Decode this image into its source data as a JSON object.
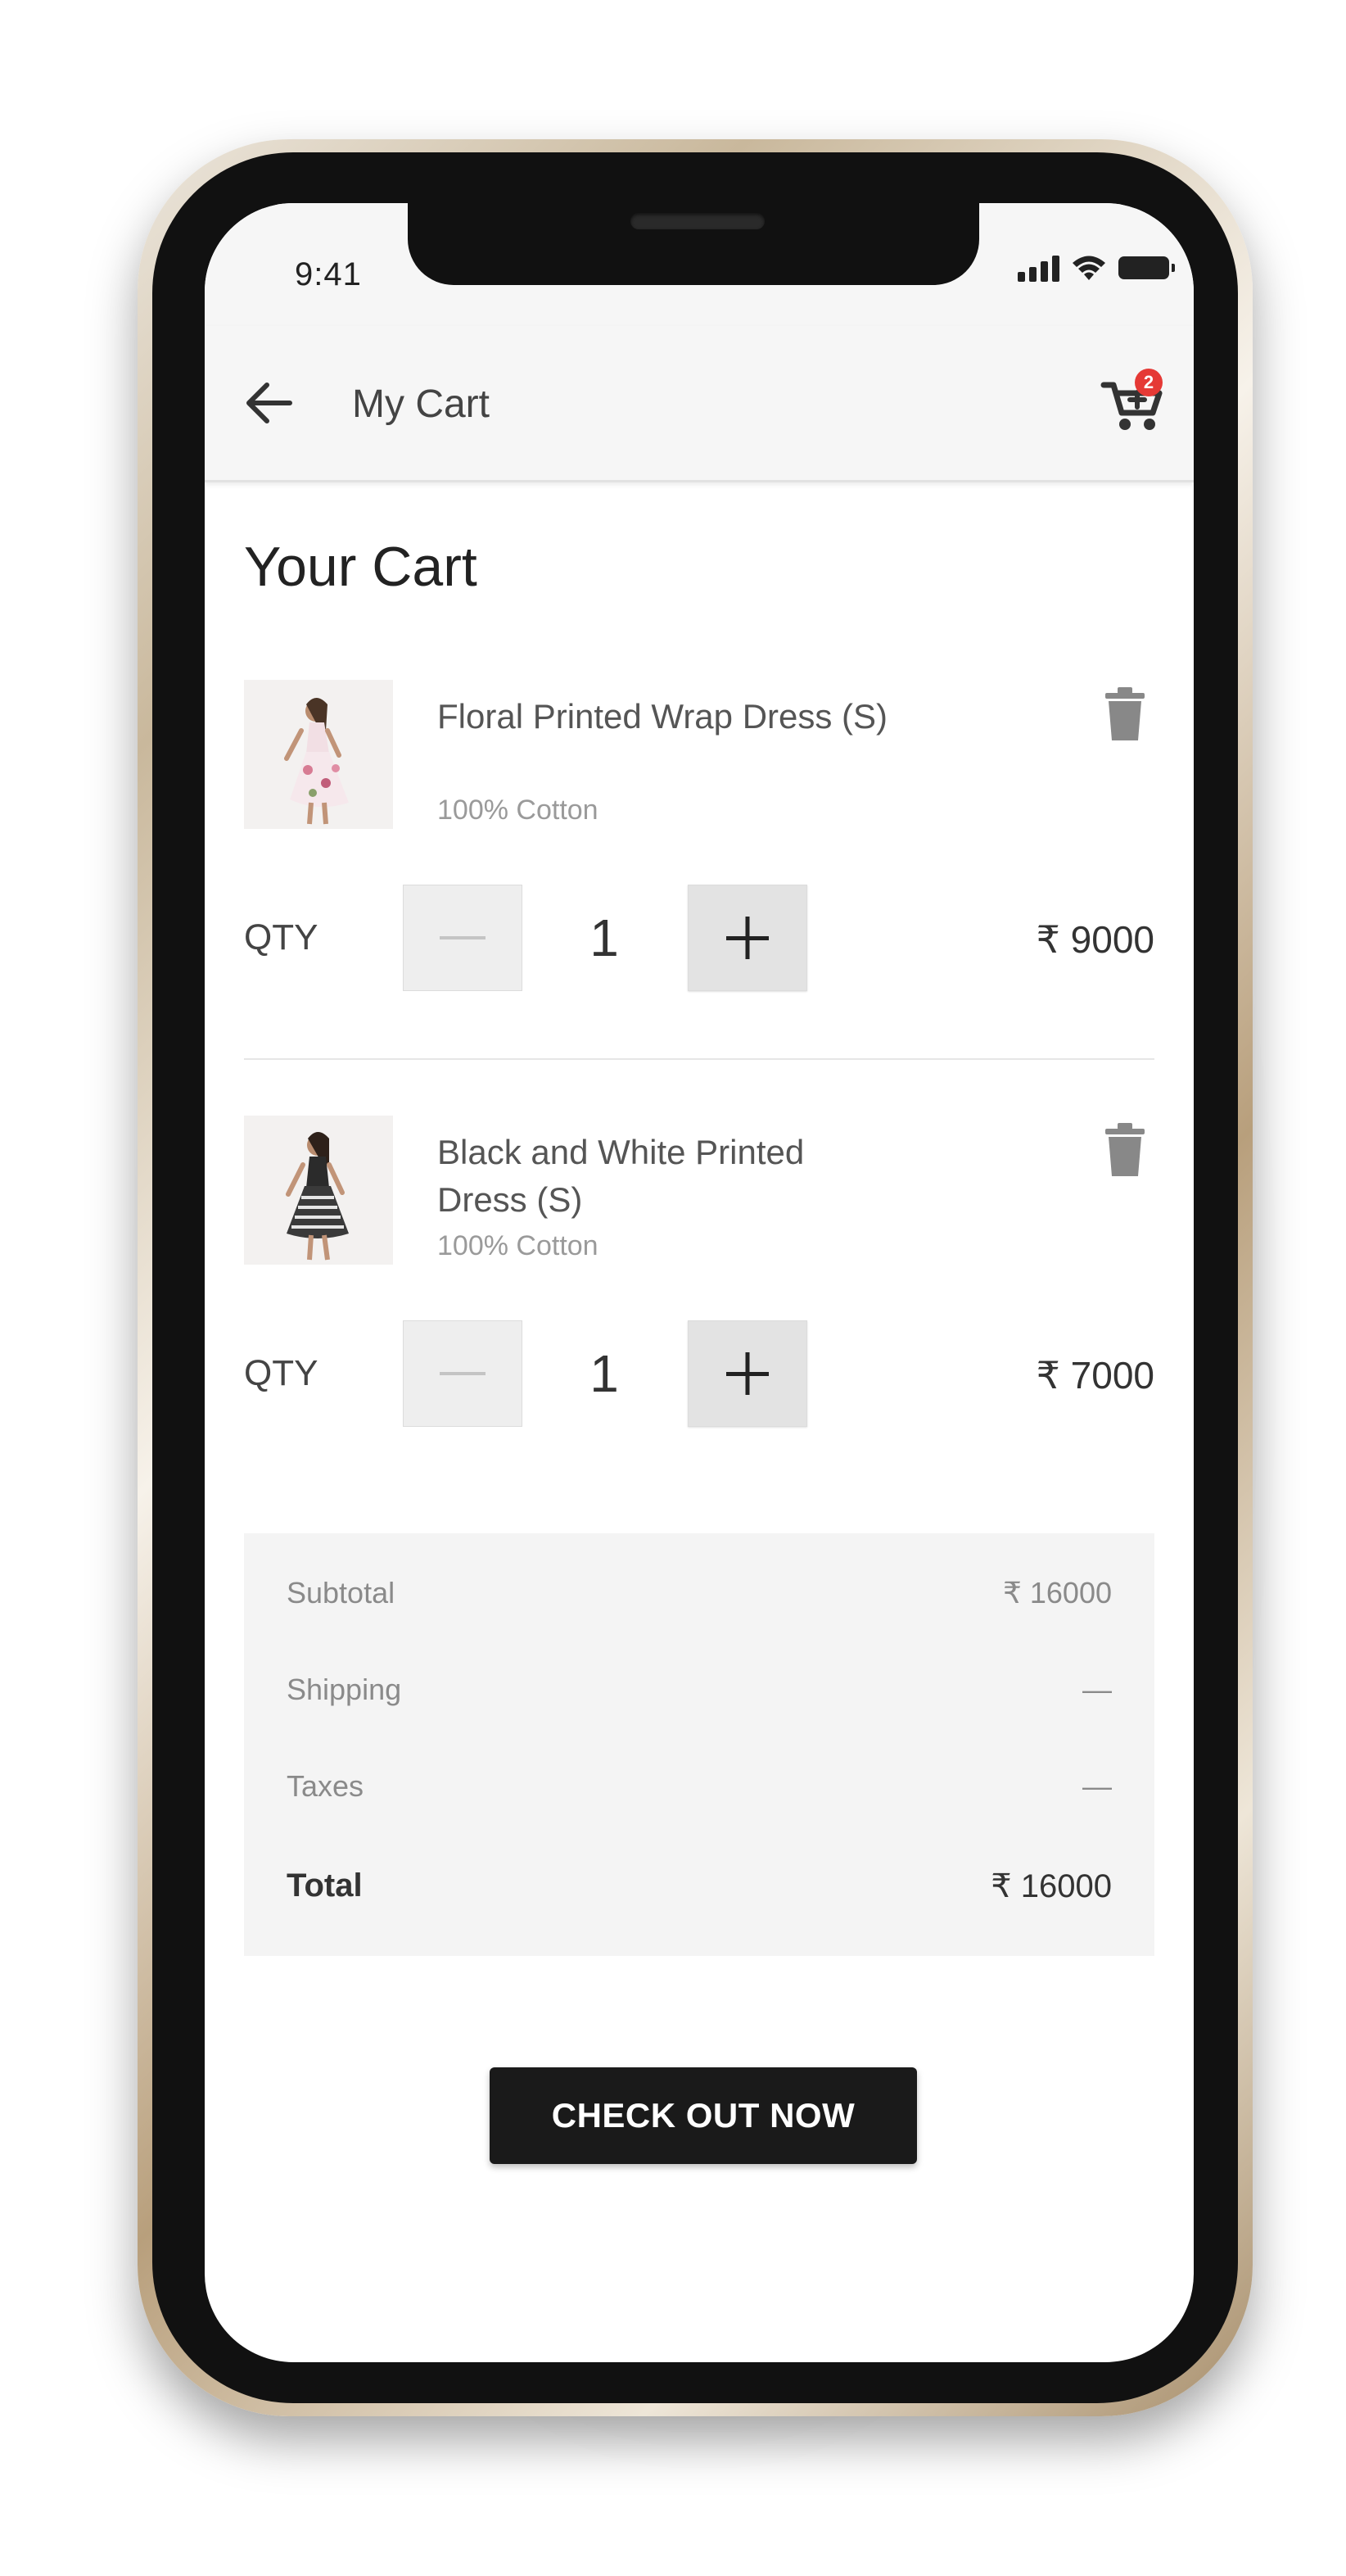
{
  "status_bar": {
    "time": "9:41",
    "icons": [
      "signal-icon",
      "wifi-icon",
      "battery-icon"
    ]
  },
  "app_bar": {
    "back_icon": "arrow-left-icon",
    "title": "My Cart",
    "cart_icon": "cart-icon",
    "cart_badge_count": "2",
    "badge_color": "#e53935"
  },
  "page": {
    "heading": "Your Cart"
  },
  "cart_items": [
    {
      "name": "Floral Printed Wrap Dress (S)",
      "material": "100% Cotton",
      "qty_label": "QTY",
      "qty": "1",
      "price": "₹ 9000",
      "image": "floral-dress-photo",
      "delete_icon": "trash-icon"
    },
    {
      "name": "Black and White Printed Dress (S)",
      "material": "100% Cotton",
      "qty_label": "QTY",
      "qty": "1",
      "price": "₹ 7000",
      "image": "black-white-dress-photo",
      "delete_icon": "trash-icon"
    }
  ],
  "summary": {
    "subtotal_label": "Subtotal",
    "subtotal_value": "₹ 16000",
    "shipping_label": "Shipping",
    "shipping_value": "—",
    "taxes_label": "Taxes",
    "taxes_value": "—",
    "total_label": "Total",
    "total_value": "₹ 16000"
  },
  "checkout": {
    "label": "CHECK OUT NOW",
    "color": "#1a1a1a"
  }
}
